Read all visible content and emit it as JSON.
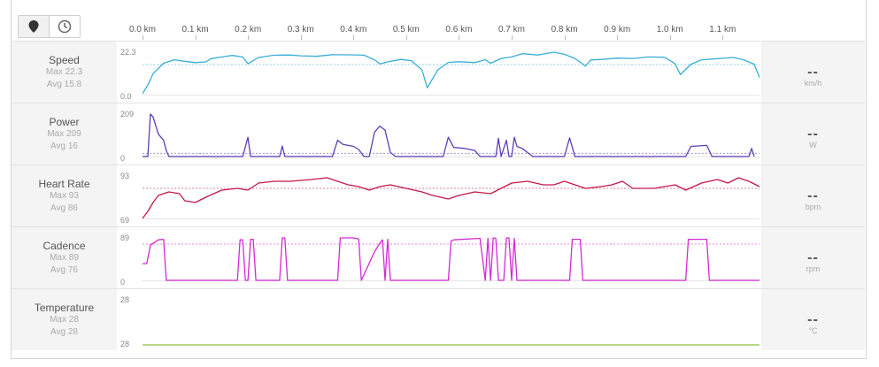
{
  "toolbar": {
    "items": [
      {
        "icon": "map-pin-icon",
        "active": true
      },
      {
        "icon": "clock-icon",
        "active": false
      }
    ]
  },
  "x_axis": {
    "ticks": [
      "0.0 km",
      "0.1 km",
      "0.2 km",
      "0.3 km",
      "0.4 km",
      "0.5 km",
      "0.6 km",
      "0.7 km",
      "0.8 km",
      "0.9 km",
      "1.0 km",
      "1.1 km"
    ],
    "values": [
      0.0,
      0.1,
      0.2,
      0.3,
      0.4,
      0.5,
      0.6,
      0.7,
      0.8,
      0.9,
      1.0,
      1.1
    ],
    "range": [
      0.0,
      1.17
    ],
    "unit": "km"
  },
  "rows": [
    {
      "name": "Speed",
      "max_label": "Max 22.3",
      "avg_label": "Avg 15.8",
      "current": "--",
      "unit": "km/h"
    },
    {
      "name": "Power",
      "max_label": "Max 209",
      "avg_label": "Avg 16",
      "current": "--",
      "unit": "W"
    },
    {
      "name": "Heart Rate",
      "max_label": "Max 93",
      "avg_label": "Avg 86",
      "current": "--",
      "unit": "bpm"
    },
    {
      "name": "Cadence",
      "max_label": "Max 89",
      "avg_label": "Avg 76",
      "current": "--",
      "unit": "rpm"
    },
    {
      "name": "Temperature",
      "max_label": "Max 28",
      "avg_label": "Avg 28",
      "current": "--",
      "unit": "°C"
    }
  ],
  "chart_data": [
    {
      "type": "line",
      "name": "Speed",
      "color": "#3aaed8",
      "ylim": [
        0.0,
        22.3
      ],
      "ytick_labels": [
        "22.3",
        "0.0"
      ],
      "avg": 15.8,
      "x": [
        0.0,
        0.01,
        0.02,
        0.04,
        0.06,
        0.08,
        0.1,
        0.12,
        0.13,
        0.15,
        0.17,
        0.19,
        0.2,
        0.22,
        0.25,
        0.28,
        0.3,
        0.33,
        0.36,
        0.39,
        0.42,
        0.44,
        0.45,
        0.47,
        0.49,
        0.51,
        0.53,
        0.54,
        0.56,
        0.58,
        0.6,
        0.63,
        0.65,
        0.66,
        0.68,
        0.7,
        0.72,
        0.75,
        0.78,
        0.8,
        0.82,
        0.84,
        0.85,
        0.87,
        0.9,
        0.93,
        0.96,
        0.99,
        1.01,
        1.02,
        1.04,
        1.06,
        1.09,
        1.12,
        1.14,
        1.16,
        1.17
      ],
      "y": [
        0.5,
        5.0,
        11.0,
        16.5,
        18.3,
        17.5,
        16.8,
        17.2,
        18.9,
        19.8,
        20.6,
        19.8,
        16.2,
        19.5,
        20.7,
        20.8,
        20.4,
        20.1,
        21.0,
        20.9,
        20.7,
        18.3,
        16.1,
        17.5,
        18.5,
        17.8,
        13.0,
        3.6,
        13.0,
        16.9,
        17.3,
        16.8,
        18.3,
        16.5,
        19.0,
        19.8,
        21.5,
        20.8,
        22.3,
        21.2,
        19.0,
        15.0,
        18.2,
        18.5,
        19.2,
        19.0,
        19.8,
        19.6,
        16.2,
        10.5,
        16.0,
        18.3,
        18.9,
        19.5,
        18.3,
        16.0,
        9.0
      ]
    },
    {
      "type": "line",
      "name": "Power",
      "color": "#5b3fb8",
      "ylim": [
        0,
        209
      ],
      "ytick_labels": [
        "209",
        "0"
      ],
      "avg": 16,
      "x": [
        0.0,
        0.01,
        0.015,
        0.02,
        0.03,
        0.04,
        0.045,
        0.05,
        0.06,
        0.19,
        0.2,
        0.205,
        0.26,
        0.265,
        0.27,
        0.36,
        0.37,
        0.38,
        0.39,
        0.4,
        0.41,
        0.42,
        0.43,
        0.44,
        0.45,
        0.46,
        0.47,
        0.48,
        0.49,
        0.5,
        0.57,
        0.58,
        0.59,
        0.61,
        0.62,
        0.63,
        0.64,
        0.66,
        0.67,
        0.675,
        0.68,
        0.69,
        0.695,
        0.7,
        0.705,
        0.71,
        0.72,
        0.73,
        0.74,
        0.8,
        0.81,
        0.82,
        1.03,
        1.04,
        1.07,
        1.08,
        1.15,
        1.155,
        1.16
      ],
      "y": [
        0,
        0,
        209,
        195,
        110,
        80,
        30,
        0,
        0,
        0,
        95,
        0,
        0,
        52,
        0,
        0,
        80,
        60,
        55,
        50,
        35,
        0,
        0,
        120,
        150,
        130,
        20,
        0,
        0,
        0,
        0,
        95,
        45,
        40,
        35,
        30,
        0,
        0,
        0,
        90,
        0,
        80,
        0,
        0,
        95,
        50,
        40,
        20,
        0,
        0,
        92,
        0,
        0,
        50,
        55,
        0,
        0,
        40,
        0
      ]
    },
    {
      "type": "line",
      "name": "Heart Rate",
      "color": "#c41847",
      "ylim": [
        69,
        93
      ],
      "ytick_labels": [
        "93",
        "69"
      ],
      "avg": 86,
      "x": [
        0.0,
        0.01,
        0.02,
        0.03,
        0.05,
        0.07,
        0.08,
        0.1,
        0.12,
        0.15,
        0.18,
        0.2,
        0.22,
        0.25,
        0.28,
        0.32,
        0.35,
        0.37,
        0.39,
        0.41,
        0.43,
        0.45,
        0.47,
        0.5,
        0.53,
        0.55,
        0.58,
        0.6,
        0.63,
        0.66,
        0.68,
        0.7,
        0.73,
        0.76,
        0.78,
        0.8,
        0.82,
        0.84,
        0.87,
        0.89,
        0.91,
        0.93,
        0.95,
        0.97,
        0.99,
        1.01,
        1.03,
        1.06,
        1.09,
        1.11,
        1.13,
        1.15,
        1.17
      ],
      "y": [
        69,
        73,
        78,
        82,
        84,
        83,
        79,
        78,
        81,
        85,
        86,
        85,
        89,
        90,
        90,
        91,
        92,
        90,
        88,
        87,
        85,
        87,
        88,
        86,
        84,
        82,
        80,
        82,
        84,
        83,
        86,
        89,
        90,
        88,
        88,
        90,
        88,
        86,
        87,
        88,
        90,
        86,
        86,
        86,
        87,
        88,
        85,
        89,
        91,
        89,
        92,
        90,
        87
      ]
    },
    {
      "type": "line",
      "name": "Cadence",
      "color": "#d42ad4",
      "ylim": [
        0,
        89
      ],
      "ytick_labels": [
        "89",
        "0"
      ],
      "avg": 76,
      "x": [
        0.0,
        0.008,
        0.015,
        0.03,
        0.04,
        0.045,
        0.05,
        0.18,
        0.185,
        0.19,
        0.195,
        0.2,
        0.205,
        0.21,
        0.215,
        0.22,
        0.26,
        0.265,
        0.27,
        0.275,
        0.37,
        0.375,
        0.4,
        0.41,
        0.415,
        0.44,
        0.45,
        0.455,
        0.46,
        0.465,
        0.47,
        0.58,
        0.585,
        0.59,
        0.64,
        0.65,
        0.655,
        0.66,
        0.665,
        0.67,
        0.675,
        0.685,
        0.69,
        0.695,
        0.7,
        0.705,
        0.71,
        0.72,
        0.725,
        0.81,
        0.815,
        0.83,
        0.835,
        1.03,
        1.035,
        1.07,
        1.075,
        1.17
      ],
      "y": [
        35,
        35,
        74,
        85,
        86,
        0,
        0,
        0,
        85,
        85,
        0,
        0,
        86,
        86,
        0,
        0,
        0,
        89,
        89,
        0,
        0,
        89,
        89,
        87,
        0,
        60,
        78,
        85,
        0,
        86,
        0,
        0,
        82,
        85,
        88,
        0,
        88,
        0,
        89,
        88,
        0,
        0,
        89,
        89,
        0,
        88,
        0,
        0,
        0,
        0,
        86,
        86,
        0,
        0,
        86,
        86,
        0,
        0
      ]
    },
    {
      "type": "line",
      "name": "Temperature",
      "color": "#8dbf3a",
      "ylim": [
        28,
        28
      ],
      "ytick_labels": [
        "28",
        "28"
      ],
      "avg": 28,
      "x": [
        0.0,
        1.17
      ],
      "y": [
        28,
        28
      ]
    }
  ]
}
